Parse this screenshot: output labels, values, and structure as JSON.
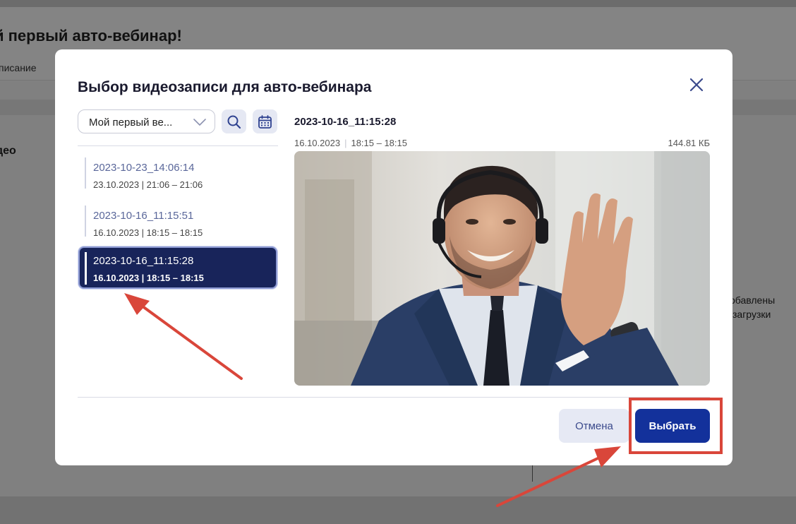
{
  "background": {
    "page_title": "й первый авто-вебинар!",
    "tab_label": "писание",
    "video_label": "део",
    "info_line1": "обавлены",
    "info_line2": "загрузки"
  },
  "modal": {
    "title": "Выбор видеозаписи для авто-вебинара",
    "close_icon": "close-icon",
    "filter": {
      "selected": "Мой первый ве...",
      "icon": "chevron-down-icon"
    },
    "search_icon": "search-icon",
    "calendar_icon": "calendar-icon",
    "recordings": [
      {
        "name": "2023-10-23_14:06:14",
        "meta": "23.10.2023  |  21:06 – 21:06",
        "selected": false
      },
      {
        "name": "2023-10-16_11:15:51",
        "meta": "16.10.2023  |  18:15 – 18:15",
        "selected": false
      },
      {
        "name": "2023-10-16_11:15:28",
        "meta": "16.10.2023  |  18:15 – 18:15",
        "selected": true
      }
    ],
    "preview": {
      "title": "2023-10-16_11:15:28",
      "date": "16.10.2023",
      "time": "18:15 – 18:15",
      "size": "144.81 КБ"
    },
    "buttons": {
      "cancel": "Отмена",
      "choose": "Выбрать"
    }
  },
  "colors": {
    "accent": "#13319b",
    "selected_bg": "#18245a",
    "annotation": "#d9463a"
  }
}
